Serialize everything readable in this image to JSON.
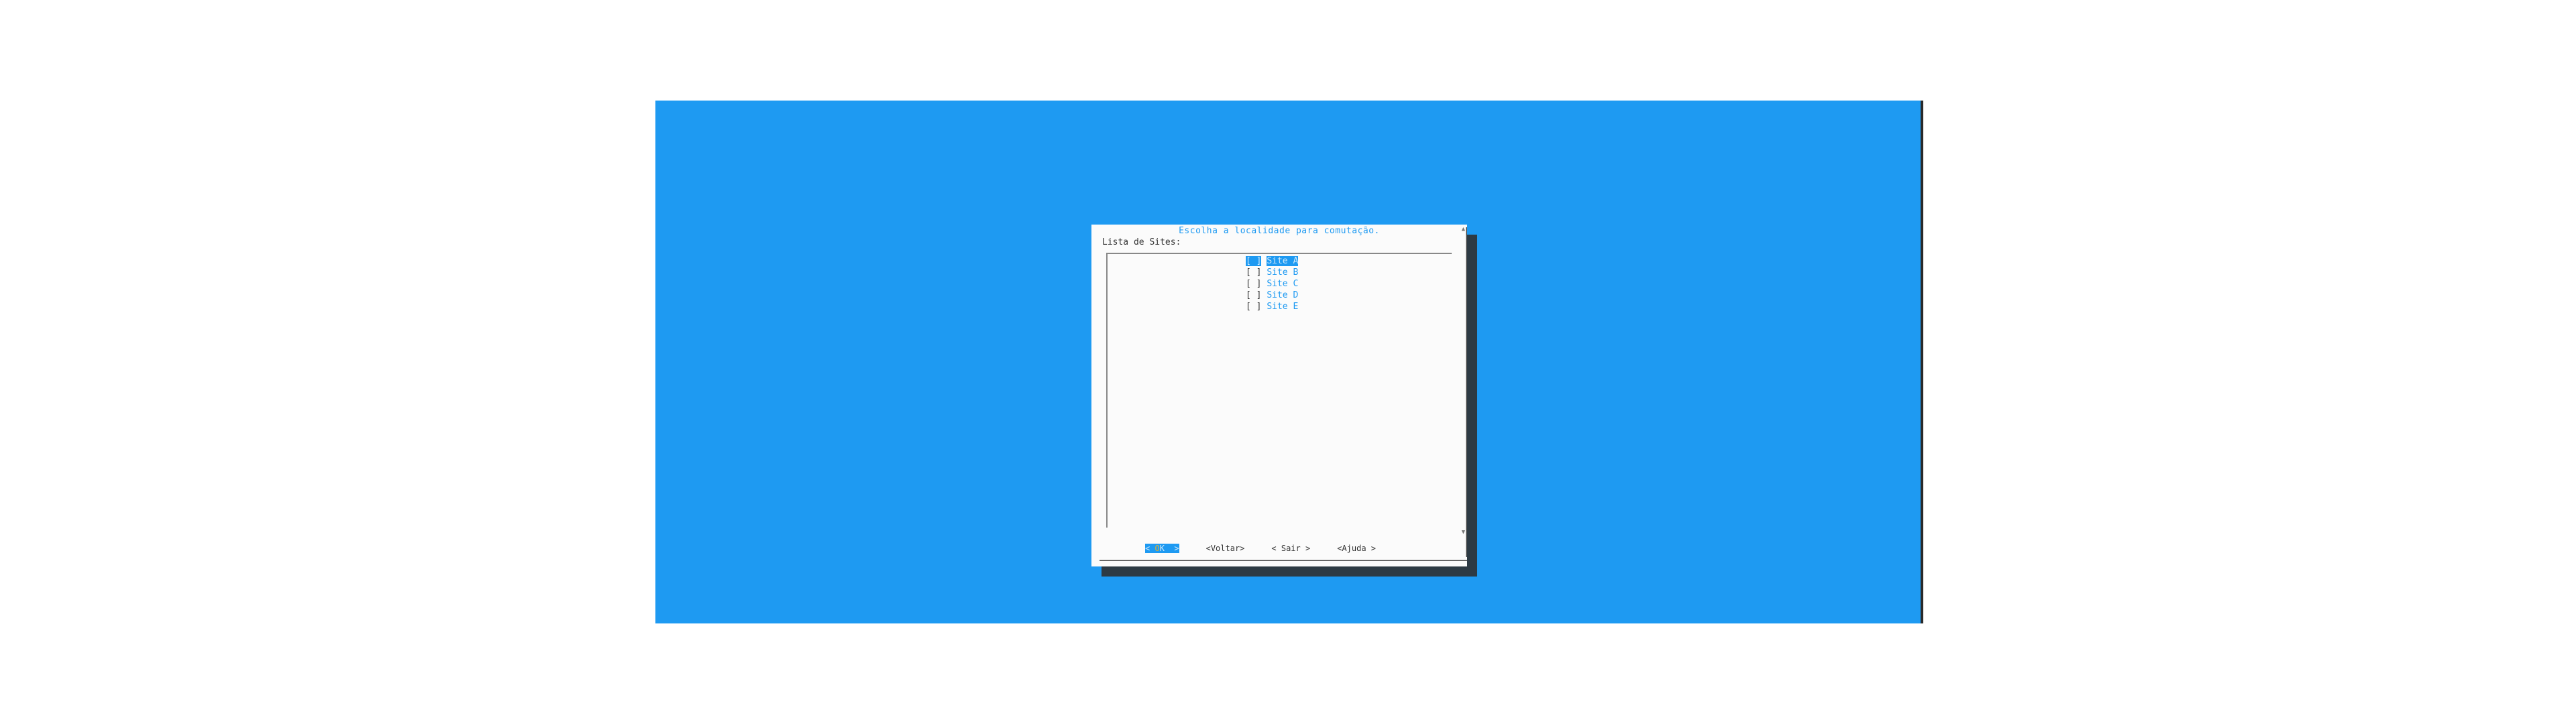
{
  "dialog": {
    "title": "Escolha a localidade para comutação.",
    "list_label": "Lista de Sites:"
  },
  "list": {
    "items": [
      {
        "box": "[ ]",
        "label": "Site A",
        "selected": true
      },
      {
        "box": "[ ]",
        "label": "Site B",
        "selected": false
      },
      {
        "box": "[ ]",
        "label": "Site C",
        "selected": false
      },
      {
        "box": "[ ]",
        "label": "Site D",
        "selected": false
      },
      {
        "box": "[ ]",
        "label": "Site E",
        "selected": false
      }
    ]
  },
  "buttons": {
    "ok": {
      "left": "< ",
      "hot": "O",
      "rest": "K",
      "right": "  >"
    },
    "back": "<Voltar>",
    "exit": "< Sair >",
    "help": "<Ajuda >"
  },
  "colors": {
    "terminal_bg": "#1e9af2",
    "dialog_bg": "#fbfbfb",
    "accent": "#1e9af2",
    "hotkey": "#e3b02b",
    "shadow": "#2d3a44"
  }
}
